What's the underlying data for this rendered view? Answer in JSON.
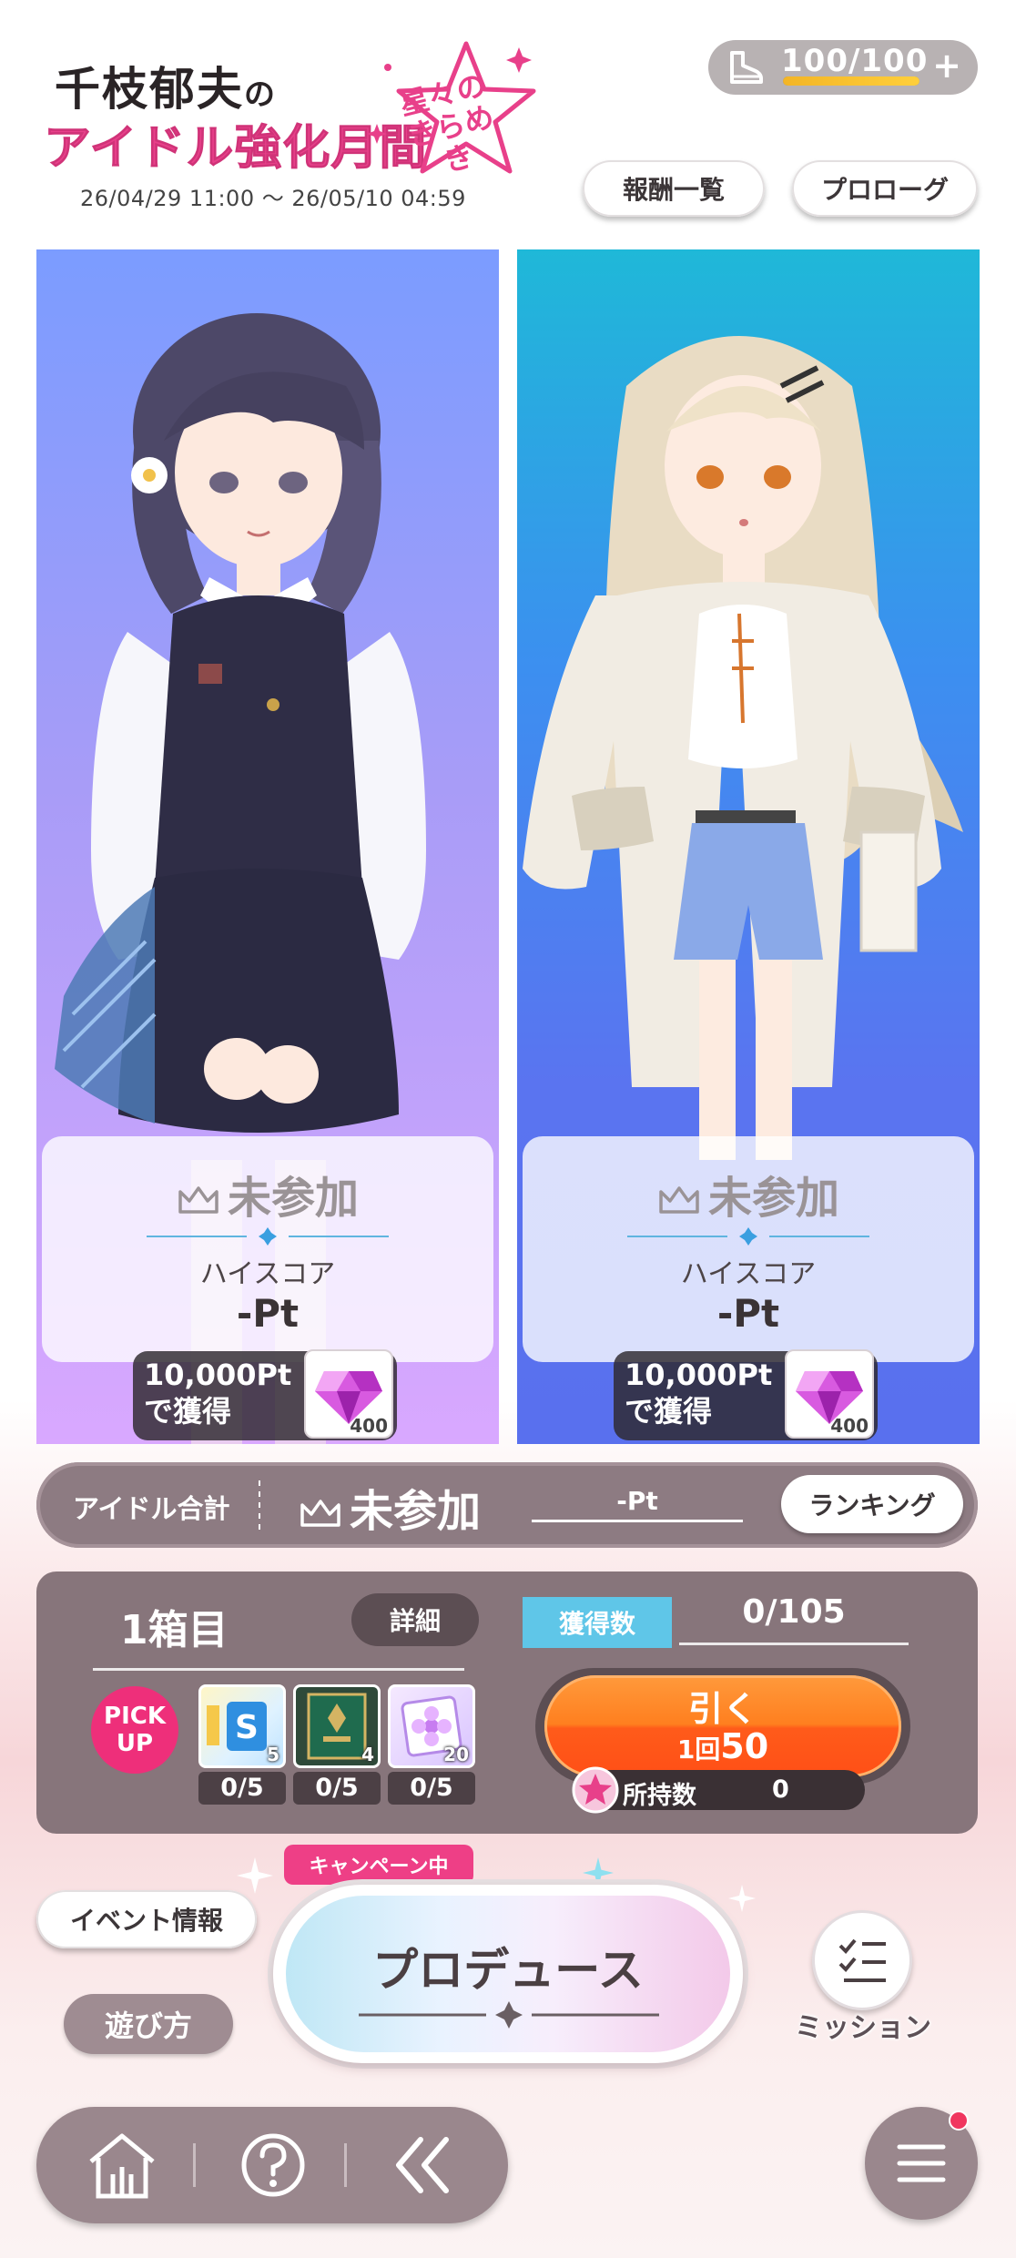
{
  "header": {
    "logo_line1_name": "千枝郁夫",
    "logo_line1_particle": "の",
    "logo_line2": "アイドル強化月間",
    "logo_badge": "星々の きらめき",
    "period": "26/04/29 11:00 ～ 26/05/10 04:59",
    "stamina": {
      "text": "100/100",
      "current": 100,
      "max": 100,
      "plus": "+"
    },
    "rewards_button": "報酬一覧",
    "prologue_button": "プロローグ"
  },
  "idols": [
    {
      "status": "未参加",
      "score_label": "ハイスコア",
      "score_value": "-Pt",
      "reward_line1": "10,000Pt",
      "reward_line2": "で獲得",
      "reward_count": "400",
      "bg_color": "#7b9cff"
    },
    {
      "status": "未参加",
      "score_label": "ハイスコア",
      "score_value": "-Pt",
      "reward_line1": "10,000Pt",
      "reward_line2": "で獲得",
      "reward_count": "400",
      "bg_color": "#1fb8d8"
    }
  ],
  "total": {
    "label": "アイドル合計",
    "status": "未参加",
    "points": "-Pt",
    "ranking_button": "ランキング"
  },
  "gacha": {
    "box_title": "1箱目",
    "detail_button": "詳細",
    "pickup_line1": "PICK",
    "pickup_line2": "UP",
    "items": [
      {
        "name": "support-card-item",
        "badge": "5",
        "count": "0/5"
      },
      {
        "name": "poster-item",
        "badge": "4",
        "count": "0/5"
      },
      {
        "name": "flower-card-item",
        "badge": "20",
        "count": "0/5"
      }
    ],
    "gain_label": "獲得数",
    "gain_value": "0/105",
    "draw_label": "引く",
    "draw_cost_prefix": "1回",
    "draw_cost": "50",
    "owned_label": "所持数",
    "owned_value": "0"
  },
  "lower": {
    "campaign": "キャンペーン中",
    "produce_button": "プロデュース",
    "event_info_button": "イベント情報",
    "howto_button": "遊び方",
    "mission_label": "ミッション"
  },
  "colors": {
    "accent_pink": "#e8408a",
    "draw_orange": "#ff7f1f",
    "gain_blue": "#5fc6e8",
    "panel_brown": "#87757b"
  }
}
